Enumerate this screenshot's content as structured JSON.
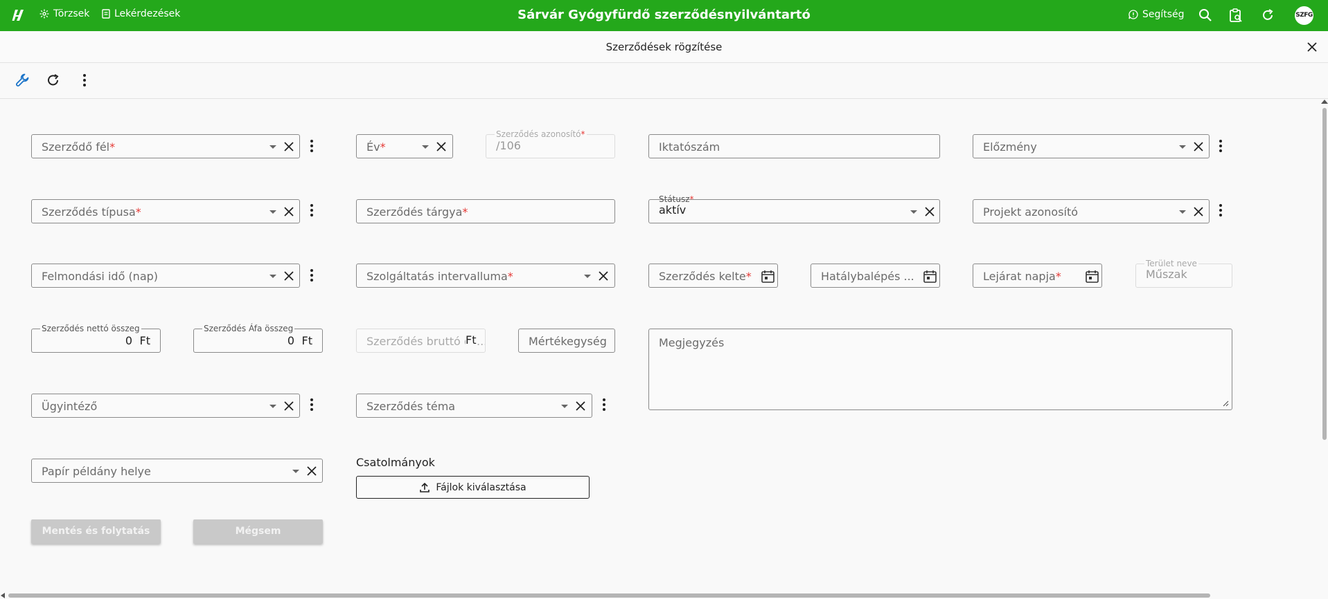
{
  "topbar": {
    "nav": [
      "Törzsek",
      "Lekérdezések"
    ],
    "app_title": "Sárvár Gyógyfürdő szerződésnyilvántartó",
    "help_label": "Segítség",
    "avatar": "SZFG",
    "background": "#24a81b"
  },
  "subheader": {
    "title": "Szerződések rögzítése"
  },
  "form": {
    "szerzodo_fel": "Szerződő fél",
    "ev": "Év",
    "azonosito_label": "Szerződés azonosító",
    "azonosito_value": "/106",
    "iktatoszam": "Iktatószám",
    "elozmeny": "Előzmény",
    "tipus": "Szerződés típusa",
    "targy": "Szerződés tárgya",
    "statusz_label": "Státusz",
    "statusz_value": "aktív",
    "projekt": "Projekt azonosító",
    "felmondasi": "Felmondási idő (nap)",
    "intervallum": "Szolgáltatás intervalluma",
    "kelte": "Szerződés kelte",
    "hatalybalepes": "Hatálybalépés ...",
    "lejarat": "Lejárat napja",
    "terulet_label": "Terület neve",
    "terulet_value": "Műszak",
    "netto_label": "Szerződés nettó összeg",
    "netto_value": "0",
    "afa_label": "Szerződés Áfa összeg",
    "afa_value": "0",
    "brutto": "Szerződés bruttó ös...",
    "currency": "Ft",
    "mertekegyseg": "Mértékegység",
    "megjegyzes": "Megjegyzés",
    "ugyintezo": "Ügyintéző",
    "tema": "Szerződés téma",
    "papir": "Papír példány helye",
    "required_mark": "*"
  },
  "attachments": {
    "label": "Csatolmányok",
    "button": "Fájlok kiválasztása"
  },
  "actions": {
    "save": "Mentés és folytatás",
    "cancel": "Mégsem"
  }
}
